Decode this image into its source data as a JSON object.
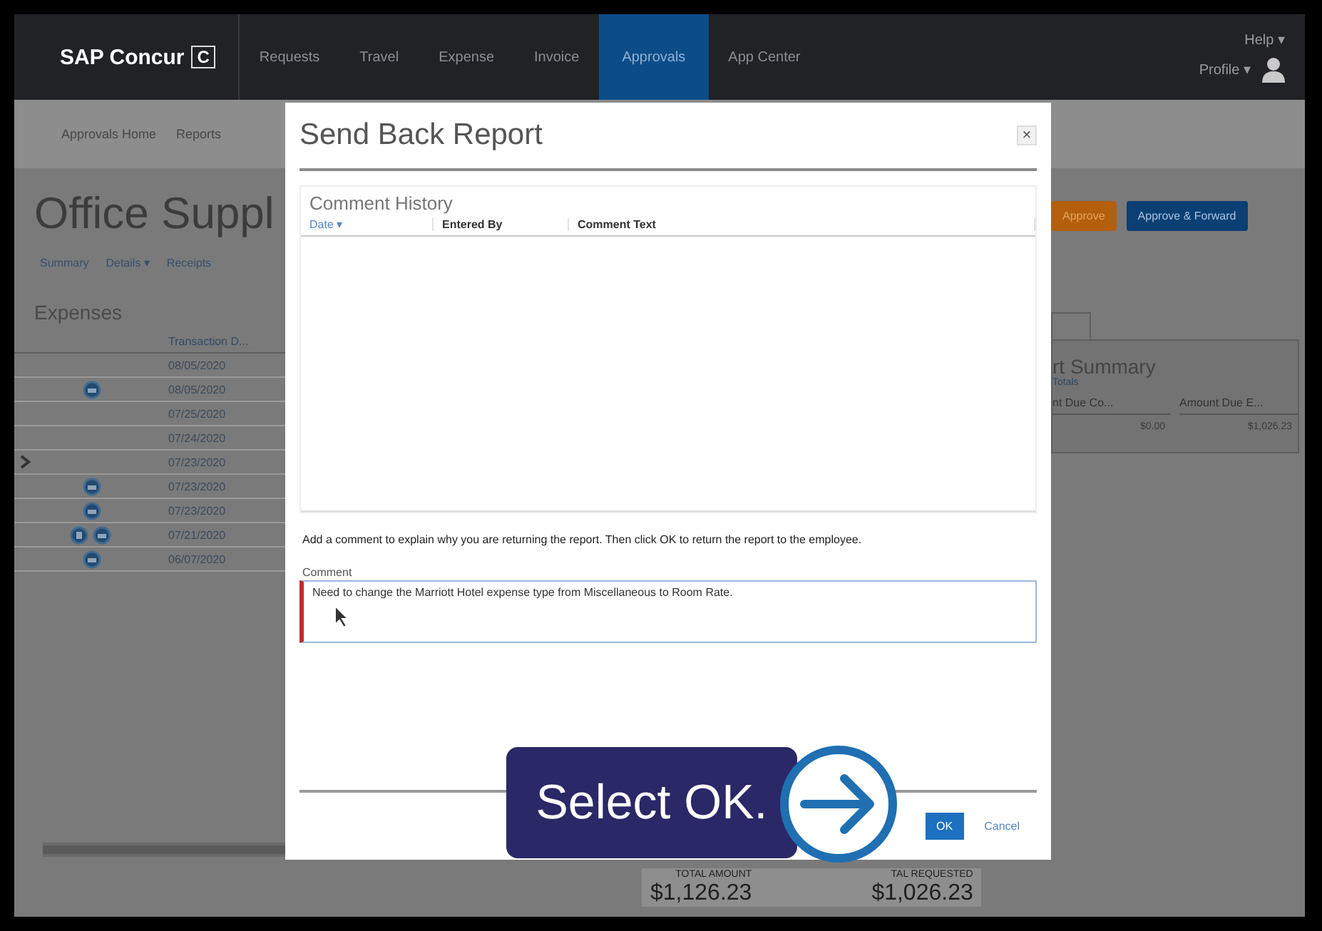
{
  "nav": {
    "logo": "SAP Concur",
    "logo_mark": "C",
    "items": [
      {
        "label": "Requests",
        "selected": false
      },
      {
        "label": "Travel",
        "selected": false
      },
      {
        "label": "Expense",
        "selected": false
      },
      {
        "label": "Invoice",
        "selected": false
      },
      {
        "label": "Approvals",
        "selected": true
      },
      {
        "label": "App Center",
        "selected": false
      }
    ],
    "help": "Help ▾",
    "profile": "Profile ▾"
  },
  "subnav": [
    "Approvals Home",
    "Reports"
  ],
  "report": {
    "title": "Office Suppl",
    "links": [
      "Summary",
      "Details ▾",
      "Receipts"
    ],
    "section": "Expenses",
    "column": "Transaction D...",
    "rows": [
      {
        "kind": "none",
        "date": "08/05/2020"
      },
      {
        "kind": "receipt",
        "date": "08/05/2020"
      },
      {
        "kind": "none",
        "date": "07/25/2020"
      },
      {
        "kind": "none",
        "date": "07/24/2020"
      },
      {
        "kind": "expand",
        "date": "07/23/2020"
      },
      {
        "kind": "receipt",
        "date": "07/23/2020"
      },
      {
        "kind": "receipt",
        "date": "07/23/2020"
      },
      {
        "kind": "pair",
        "date": "07/21/2020"
      },
      {
        "kind": "receipt",
        "date": "06/07/2020"
      }
    ]
  },
  "actions": [
    {
      "label": "Approve",
      "kind": "orange"
    },
    {
      "label": "Approve & Forward",
      "kind": "blue"
    }
  ],
  "summary": {
    "title": "rt Summary",
    "link": "Totals",
    "columns": [
      "nt Due Co...",
      "Amount Due E..."
    ],
    "values": [
      "$0.00",
      "$1,026.23"
    ]
  },
  "totals": [
    {
      "label": "TOTAL AMOUNT",
      "value": "$1,126.23"
    },
    {
      "label": "TAL REQUESTED",
      "value": "$1,026.23"
    }
  ],
  "dialog": {
    "title": "Send Back Report",
    "close": "×",
    "history_title": "Comment History",
    "columns": [
      {
        "label": "Date ▾",
        "sorted": true
      },
      {
        "label": "Entered By",
        "sorted": false
      },
      {
        "label": "Comment Text",
        "sorted": false
      }
    ],
    "instruction": "Add a comment to explain why you are returning the report. Then click OK to return the report to the employee.",
    "comment_label": "Comment",
    "comment_value": "Need to change the Marriott Hotel expense type from Miscellaneous to Room Rate.",
    "ok": "OK",
    "cancel": "Cancel"
  },
  "callout": {
    "text": "Select OK."
  }
}
